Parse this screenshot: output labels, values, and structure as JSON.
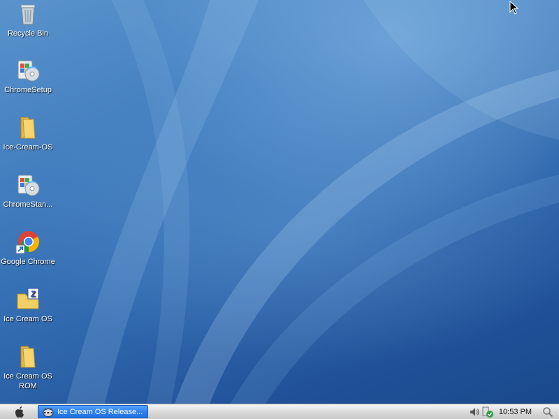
{
  "desktop": {
    "icons": [
      {
        "label": "Recycle Bin",
        "icon": "recycle-bin-icon"
      },
      {
        "label": "ChromeSetup",
        "icon": "installer-icon"
      },
      {
        "label": "Ice-Cream-OS",
        "icon": "folder-icon"
      },
      {
        "label": "ChromeStan...",
        "icon": "installer-icon"
      },
      {
        "label": "Google Chrome",
        "icon": "chrome-icon"
      },
      {
        "label": "Ice Cream OS",
        "icon": "zip-folder-icon"
      },
      {
        "label": "Ice Cream OS ROM",
        "icon": "folder-icon"
      }
    ]
  },
  "taskbar": {
    "start_icon": "apple-logo-icon",
    "task_button_label": "Ice Cream OS Release...",
    "task_button_icon": "raccoon-app-icon",
    "tray": {
      "volume_icon": "speaker-icon",
      "security_icon": "security-shield-icon",
      "clock": "10:53 PM",
      "search_icon": "search-icon"
    }
  },
  "colors": {
    "wallpaper_top": "#5a93cc",
    "wallpaper_bottom": "#1a4a8c",
    "task_button": "#2f83ef"
  }
}
